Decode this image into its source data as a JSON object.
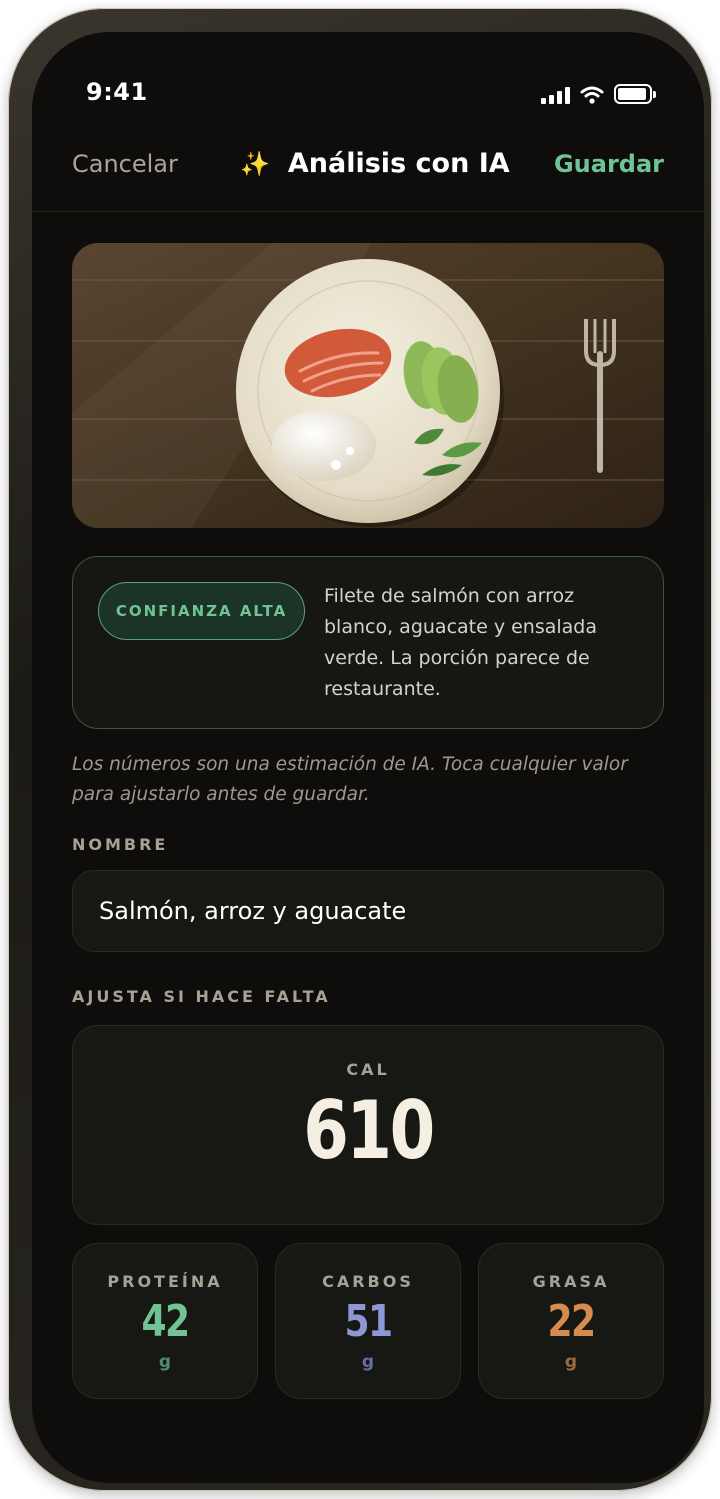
{
  "status_bar": {
    "time": "9:41"
  },
  "nav": {
    "cancel_label": "Cancelar",
    "title": "Análisis con IA",
    "save_label": "Guardar"
  },
  "analysis": {
    "confidence_badge": "CONFIANZA ALTA",
    "description": "Filete de salmón con arroz blanco, aguacate y ensalada verde. La porción parece de restaurante."
  },
  "note": "Los números son una estimación de IA. Toca cualquier valor para ajustarlo antes de guardar.",
  "name_section": {
    "label": "NOMBRE",
    "value": "Salmón, arroz y aguacate"
  },
  "adjust_section": {
    "label": "AJUSTA SI HACE FALTA",
    "calories": {
      "label": "CAL",
      "value": "610"
    },
    "macros": [
      {
        "label": "PROTEÍNA",
        "value": "42",
        "unit": "g",
        "color": "#6fc394"
      },
      {
        "label": "CARBOS",
        "value": "51",
        "unit": "g",
        "color": "#8d97d4"
      },
      {
        "label": "GRASA",
        "value": "22",
        "unit": "g",
        "color": "#d88b4f"
      }
    ]
  },
  "colors": {
    "accent": "#6fc394",
    "background": "#0e0d0b",
    "card": "#171714"
  },
  "icons": [
    "sparkles-icon",
    "signal-icon",
    "wifi-icon",
    "battery-icon",
    "fork-icon"
  ]
}
